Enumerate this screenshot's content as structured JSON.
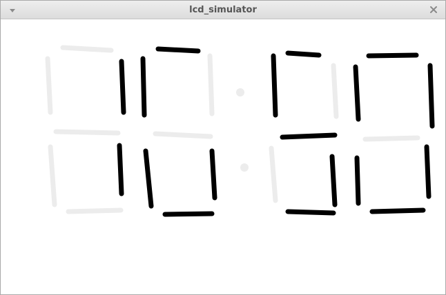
{
  "window": {
    "title": "lcd_simulator",
    "menu_icon": "triangle-down-icon",
    "close_icon": "close-icon"
  },
  "display": {
    "colors": {
      "segment_on": "#000000",
      "segment_off": "#ececec",
      "background": "#ffffff"
    },
    "digits": [
      {
        "position": "top-left",
        "segments": {
          "a": false,
          "b": true,
          "c": false,
          "d": false,
          "e": false,
          "f": false,
          "g": false
        }
      },
      {
        "position": "top-2",
        "segments": {
          "a": true,
          "b": false,
          "c": false,
          "d": false,
          "e": false,
          "f": true,
          "g": false
        }
      },
      {
        "position": "top-3",
        "segments": {
          "a": true,
          "b": false,
          "c": false,
          "d": false,
          "e": false,
          "f": true,
          "g": true
        }
      },
      {
        "position": "top-right",
        "segments": {
          "a": true,
          "b": true,
          "c": false,
          "d": false,
          "e": false,
          "f": true,
          "g": false
        }
      },
      {
        "position": "bottom-left",
        "segments": {
          "a": false,
          "b": false,
          "c": true,
          "d": false,
          "e": false,
          "f": false,
          "g": false
        }
      },
      {
        "position": "bottom-2",
        "segments": {
          "a": true,
          "b": false,
          "c": true,
          "d": true,
          "e": true,
          "f": false,
          "g": false
        }
      },
      {
        "position": "bottom-3",
        "segments": {
          "a": true,
          "b": false,
          "c": true,
          "d": true,
          "e": false,
          "f": false,
          "g": false
        }
      },
      {
        "position": "bottom-right",
        "segments": {
          "a": false,
          "b": true,
          "c": true,
          "d": true,
          "e": true,
          "f": false,
          "g": false
        }
      }
    ],
    "dots": [
      {
        "row": "top",
        "lit": false
      },
      {
        "row": "bottom",
        "lit": false
      }
    ]
  }
}
